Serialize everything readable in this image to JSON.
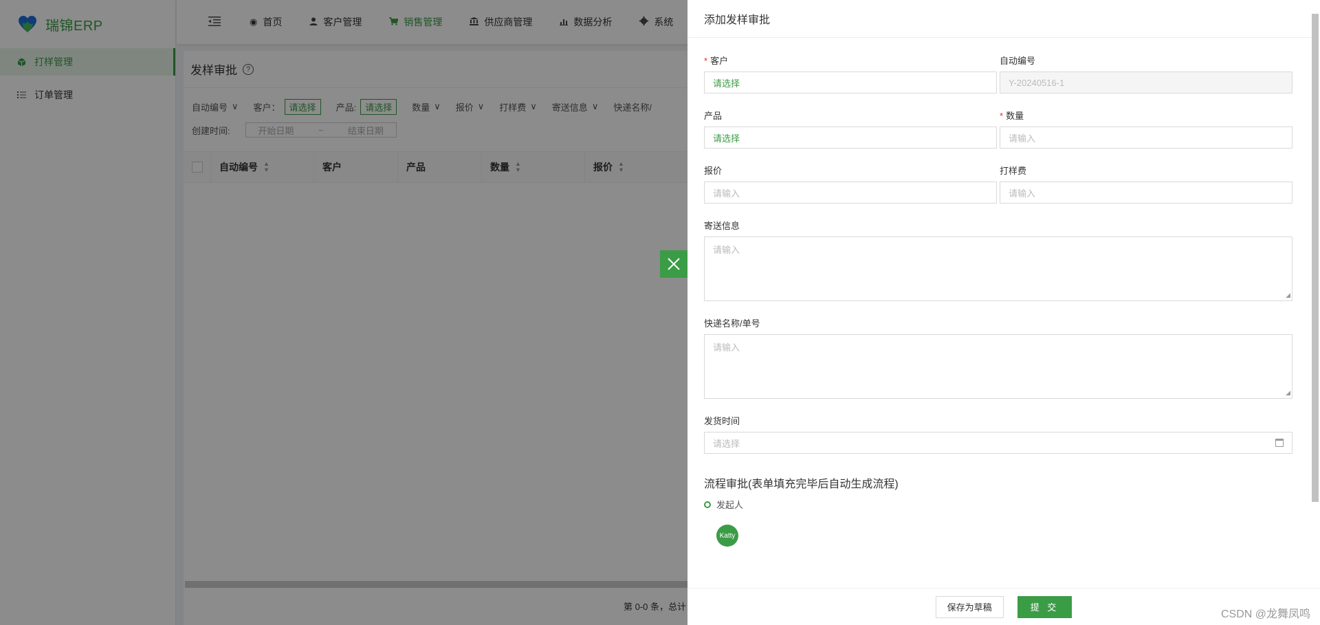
{
  "app": {
    "name": "瑞锦ERP"
  },
  "sidebar": {
    "items": [
      {
        "label": "打样管理",
        "icon": "cube-icon",
        "active": true
      },
      {
        "label": "订单管理",
        "icon": "list-icon",
        "active": false
      }
    ]
  },
  "topnav": {
    "items": [
      {
        "label": "首页",
        "icon": "dashboard-icon"
      },
      {
        "label": "客户管理",
        "icon": "user-icon"
      },
      {
        "label": "销售管理",
        "icon": "cart-icon",
        "active": true
      },
      {
        "label": "供应商管理",
        "icon": "bank-icon"
      },
      {
        "label": "数据分析",
        "icon": "chart-icon"
      },
      {
        "label": "系统",
        "icon": "gear-icon"
      }
    ]
  },
  "page": {
    "title": "发样审批",
    "filters": {
      "auto_code": "自动编号",
      "customer_label": "客户：",
      "customer_value": "请选择",
      "product_label": "产品:",
      "product_value": "请选择",
      "quantity": "数量",
      "quote": "报价",
      "sample_fee": "打样费",
      "shipping_info": "寄送信息",
      "express": "快递名称/",
      "created_label": "创建时间:",
      "start_date": "开始日期",
      "date_sep": "~",
      "end_date": "结束日期"
    },
    "table": {
      "columns": [
        "自动编号",
        "客户",
        "产品",
        "数量",
        "报价"
      ]
    },
    "pagination": "第 0-0 条，总计"
  },
  "drawer": {
    "title": "添加发样审批",
    "fields": {
      "customer": {
        "label": "客户",
        "value": "请选择"
      },
      "auto_code": {
        "label": "自动编号",
        "value": "Y-20240516-1"
      },
      "product": {
        "label": "产品",
        "value": "请选择"
      },
      "quantity": {
        "label": "数量",
        "placeholder": "请输入"
      },
      "quote": {
        "label": "报价",
        "placeholder": "请输入"
      },
      "sample_fee": {
        "label": "打样费",
        "placeholder": "请输入"
      },
      "shipping_info": {
        "label": "寄送信息",
        "placeholder": "请输入"
      },
      "express": {
        "label": "快递名称/单号",
        "placeholder": "请输入"
      },
      "ship_time": {
        "label": "发货时间",
        "placeholder": "请选择"
      }
    },
    "flow": {
      "title": "流程审批(表单填充完毕后自动生成流程)",
      "initiator_label": "发起人",
      "avatar_name": "Katty"
    },
    "buttons": {
      "save_draft": "保存为草稿",
      "submit": "提 交"
    },
    "required_mark": "*"
  },
  "watermark": "CSDN @龙舞凤鸣",
  "colors": {
    "accent": "#3b9c46",
    "required": "#f5222d"
  }
}
